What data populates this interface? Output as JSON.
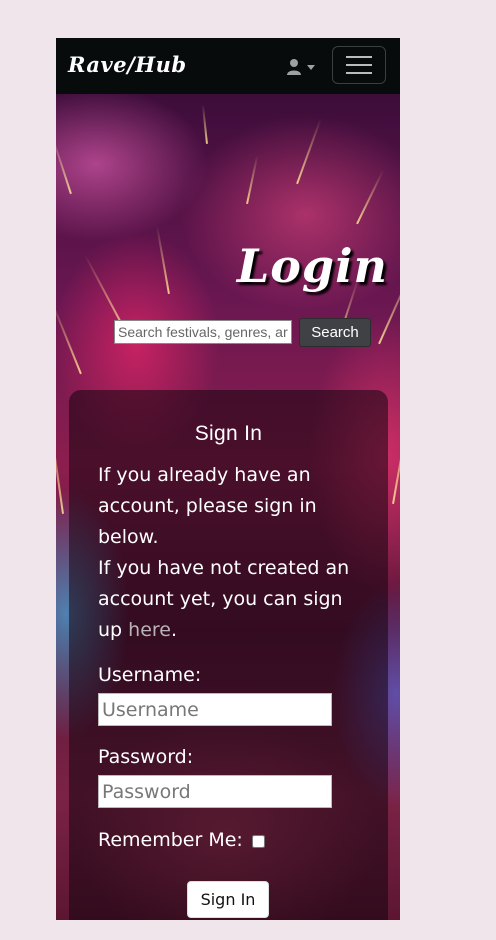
{
  "navbar": {
    "brand": "Rave/Hub",
    "user_menu": "user-icon",
    "menu_toggle": "hamburger-icon"
  },
  "hero": {
    "title": "Login",
    "search": {
      "placeholder": "Search festivals, genres, artists",
      "button_label": "Search"
    }
  },
  "signin": {
    "heading": "Sign In",
    "intro_line1": "If you already have an account, please sign in below.",
    "intro_line2_before": "If you have not created an account yet, you can sign up ",
    "intro_link": "here",
    "intro_line2_after": ".",
    "username_label": "Username:",
    "username_placeholder": "Username",
    "password_label": "Password:",
    "password_placeholder": "Password",
    "remember_label": "Remember Me:",
    "submit_label": "Sign In"
  },
  "colors": {
    "page_background": "#efe5ea",
    "navbar": "#070b0c",
    "search_button": "#3f4144",
    "link": "#b9b4b8"
  }
}
